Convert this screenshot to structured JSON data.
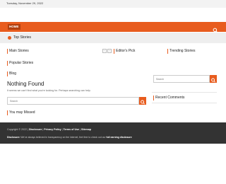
{
  "topbar": {
    "date": "Tuesday, November 29, 2022"
  },
  "nav": {
    "home_label": "HOME",
    "search_icon": "search-icon"
  },
  "top_stories": {
    "label": "Top Stories"
  },
  "sections": {
    "main_stories": "Main Stories",
    "editors_pick": "Editor's Pick",
    "trending_stories": "Trending Stories",
    "popular_stories": "Popular Stories",
    "blog": "Blog",
    "you_may_missed": "You may Missed",
    "recent_comments": "Recent Comments"
  },
  "pager": {
    "prev": "‹",
    "next": "›"
  },
  "content": {
    "not_found_title": "Nothing Found",
    "not_found_text": "It seems we can't find what you're looking for. Perhaps searching can help."
  },
  "search": {
    "placeholder": "Search"
  },
  "footer": {
    "copyright": "Copyright © 2022 |",
    "disclosure_link": "Disclosure",
    "privacy_link": "Privacy Policy",
    "terms_link": "Terms of Use",
    "sitemap_link": "Sitemap",
    "disclosure_label": "Disclosure:",
    "disclosure_text": "We've always believed in transparency on the internet, feel free to check out our",
    "earning_link": "full earning disclosure"
  },
  "colors": {
    "accent": "#e85c1e",
    "footer_bg": "#333333"
  }
}
